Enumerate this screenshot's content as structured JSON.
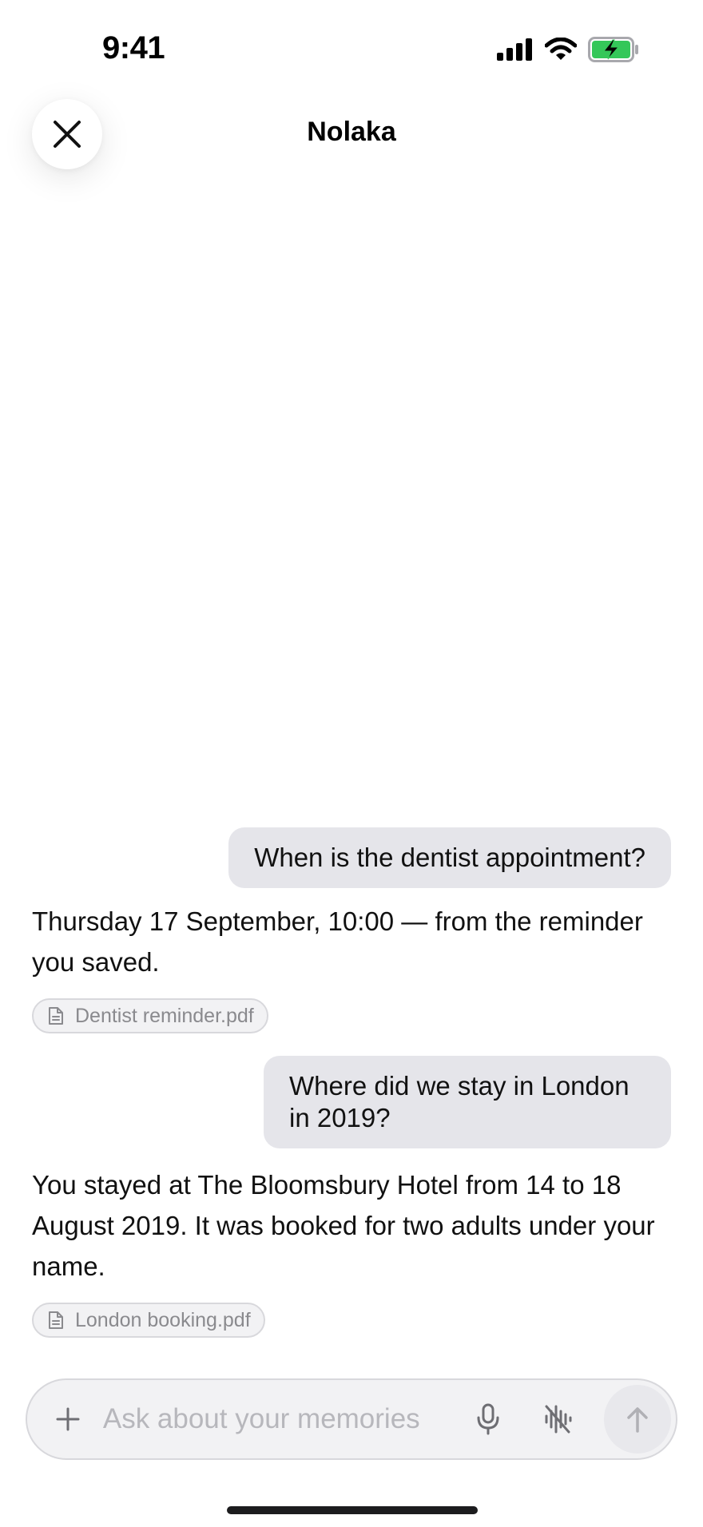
{
  "status_bar": {
    "time": "9:41",
    "icons": [
      "cellular-signal-icon",
      "wifi-icon",
      "battery-charging-icon"
    ],
    "battery_color": "#34c759"
  },
  "header": {
    "title": "Nolaka",
    "close_icon": "close-icon"
  },
  "conversation": [
    {
      "role": "user",
      "text": "When is the dentist appointment?"
    },
    {
      "role": "assistant",
      "text": "Thursday 17 September, 10:00 — from the reminder you saved.",
      "source": "Dentist reminder.pdf"
    },
    {
      "role": "user",
      "text": "Where did we stay in London in 2019?"
    },
    {
      "role": "assistant",
      "text": "You stayed at The Bloomsbury Hotel from 14 to 18 August 2019. It was booked for two adults under your name.",
      "source": "London booking.pdf"
    }
  ],
  "composer": {
    "placeholder": "Ask about your memories",
    "value": "",
    "add_icon": "plus-icon",
    "mic_icon": "microphone-icon",
    "voice_icon": "voice-mode-off-icon",
    "send_icon": "arrow-up-icon"
  },
  "colors": {
    "user_bubble": "#e5e5ea",
    "chip_text": "#8a8a8e",
    "placeholder": "#b7b7bc"
  }
}
